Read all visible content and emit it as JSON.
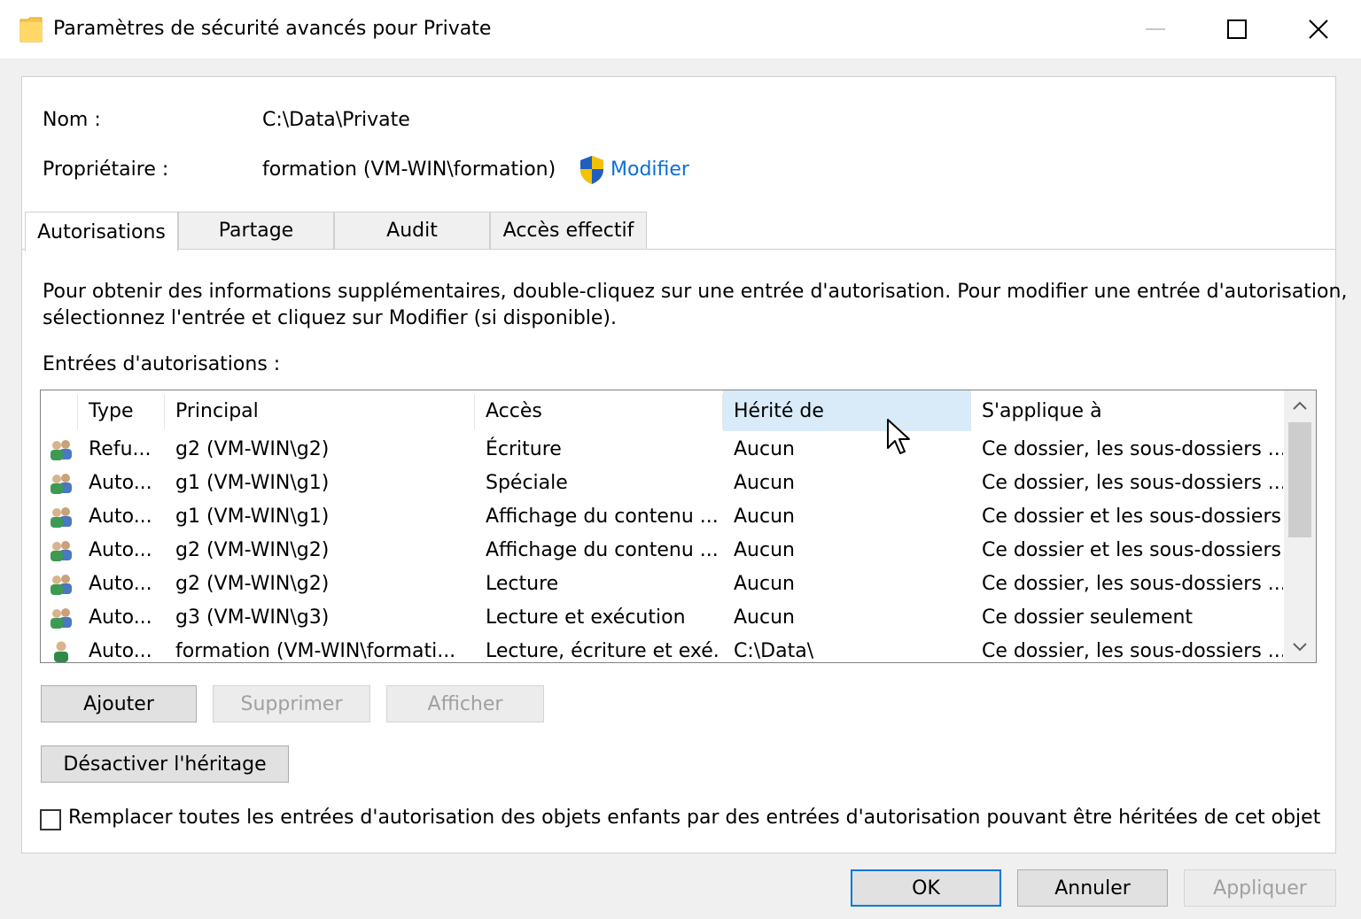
{
  "window": {
    "title": "Paramètres de sécurité avancés pour Private",
    "icon": "folder-icon",
    "controls": [
      "minimize-icon",
      "maximize-icon",
      "close-icon"
    ]
  },
  "info": {
    "name_label": "Nom :",
    "name_value": "C:\\Data\\Private",
    "owner_label": "Propriétaire :",
    "owner_value": "formation (VM-WIN\\formation)",
    "owner_link": "Modifier"
  },
  "tabs": [
    {
      "label": "Autorisations",
      "active": true
    },
    {
      "label": "Partage"
    },
    {
      "label": "Audit"
    },
    {
      "label": "Accès effectif"
    }
  ],
  "description_line1": "Pour obtenir des informations supplémentaires, double-cliquez sur une entrée d'autorisation. Pour modifier une entrée d'autorisation,",
  "description_line2": "sélectionnez l'entrée et cliquez sur Modifier (si disponible).",
  "entries_label": "Entrées d'autorisations :",
  "table": {
    "columns": [
      "Type",
      "Principal",
      "Accès",
      "Hérité de",
      "S'applique à"
    ],
    "rows": [
      {
        "icon": "group-icon",
        "type": "Refu...",
        "principal": "g2 (VM-WIN\\g2)",
        "access": "Écriture",
        "inherited": "Aucun",
        "applies": "Ce dossier, les sous-dossiers ..."
      },
      {
        "icon": "group-icon",
        "type": "Auto...",
        "principal": "g1 (VM-WIN\\g1)",
        "access": "Spéciale",
        "inherited": "Aucun",
        "applies": "Ce dossier, les sous-dossiers ..."
      },
      {
        "icon": "group-icon",
        "type": "Auto...",
        "principal": "g1 (VM-WIN\\g1)",
        "access": "Affichage du contenu ...",
        "inherited": "Aucun",
        "applies": "Ce dossier et les sous-dossiers"
      },
      {
        "icon": "group-icon",
        "type": "Auto...",
        "principal": "g2 (VM-WIN\\g2)",
        "access": "Affichage du contenu ...",
        "inherited": "Aucun",
        "applies": "Ce dossier et les sous-dossiers"
      },
      {
        "icon": "group-icon",
        "type": "Auto...",
        "principal": "g2 (VM-WIN\\g2)",
        "access": "Lecture",
        "inherited": "Aucun",
        "applies": "Ce dossier, les sous-dossiers ..."
      },
      {
        "icon": "group-icon",
        "type": "Auto...",
        "principal": "g3 (VM-WIN\\g3)",
        "access": "Lecture et exécution",
        "inherited": "Aucun",
        "applies": "Ce dossier seulement"
      },
      {
        "icon": "user-icon",
        "type": "Auto...",
        "principal": "formation (VM-WIN\\formati...",
        "access": "Lecture, écriture et exé...",
        "inherited": "C:\\Data\\",
        "applies": "Ce dossier, les sous-dossiers ..."
      }
    ]
  },
  "buttons": {
    "add": "Ajouter",
    "remove": "Supprimer",
    "view": "Afficher",
    "disable_inheritance": "Désactiver l'héritage",
    "ok": "OK",
    "cancel": "Annuler",
    "apply": "Appliquer"
  },
  "replace_checkbox": {
    "label": "Remplacer toutes les entrées d'autorisation des objets enfants par des entrées d'autorisation pouvant être héritées de cet objet",
    "checked": false
  },
  "colors": {
    "accent": "#0078d7",
    "link": "#0b6fd6",
    "header_hot": "#d9ebf9"
  }
}
